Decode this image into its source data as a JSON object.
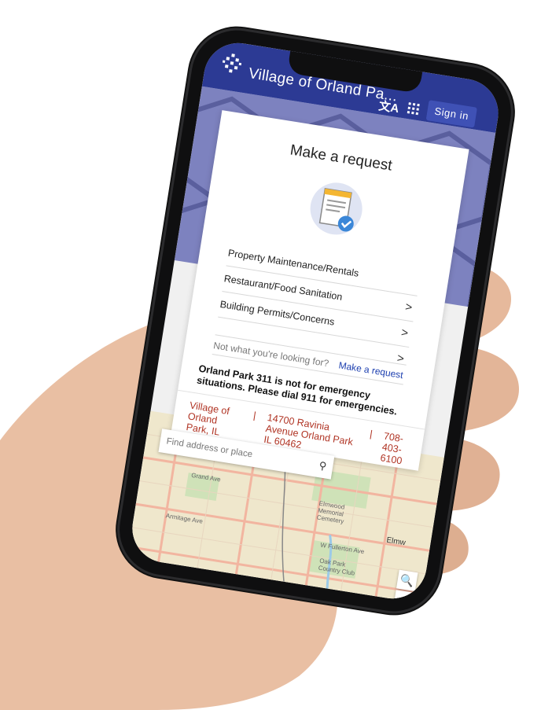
{
  "header": {
    "title": "Village of Orland Pa...",
    "translate_icon": "translate-icon",
    "apps_icon": "apps-grid-icon",
    "signin_label": "Sign in"
  },
  "card": {
    "title": "Make a request",
    "items": [
      {
        "label": "Property Maintenance/Rentals"
      },
      {
        "label": "Restaurant/Food Sanitation"
      },
      {
        "label": "Building Permits/Concerns"
      }
    ],
    "not_looking": "Not what you're looking for?",
    "make_request_link": "Make a request",
    "emergency_text": "Orland Park 311 is not for emergency situations. Please dial 911 for emergencies."
  },
  "contact": {
    "name": "Village of Orland Park, IL",
    "separator": "|",
    "address": "14700 Ravinia Avenue Orland Park IL 60462",
    "phone": "708-403-6100"
  },
  "map": {
    "search_placeholder": "Find address or place",
    "labels": {
      "grand": "Grand Ave",
      "armitage": "Armitage Ave",
      "fullerton": "W Fullerton Ave",
      "elmwood": "Elmwood Memorial Cemetery",
      "oak_park": "Oak Park Country Club",
      "elmw": "Elmw"
    },
    "zoom_in": "+",
    "zoom_search": "🔍",
    "fullscreen": "⤢"
  },
  "colors": {
    "appbar": "#2c3a94",
    "signin": "#3f51b5",
    "contact_text": "#b03424",
    "link": "#1e40b0"
  }
}
